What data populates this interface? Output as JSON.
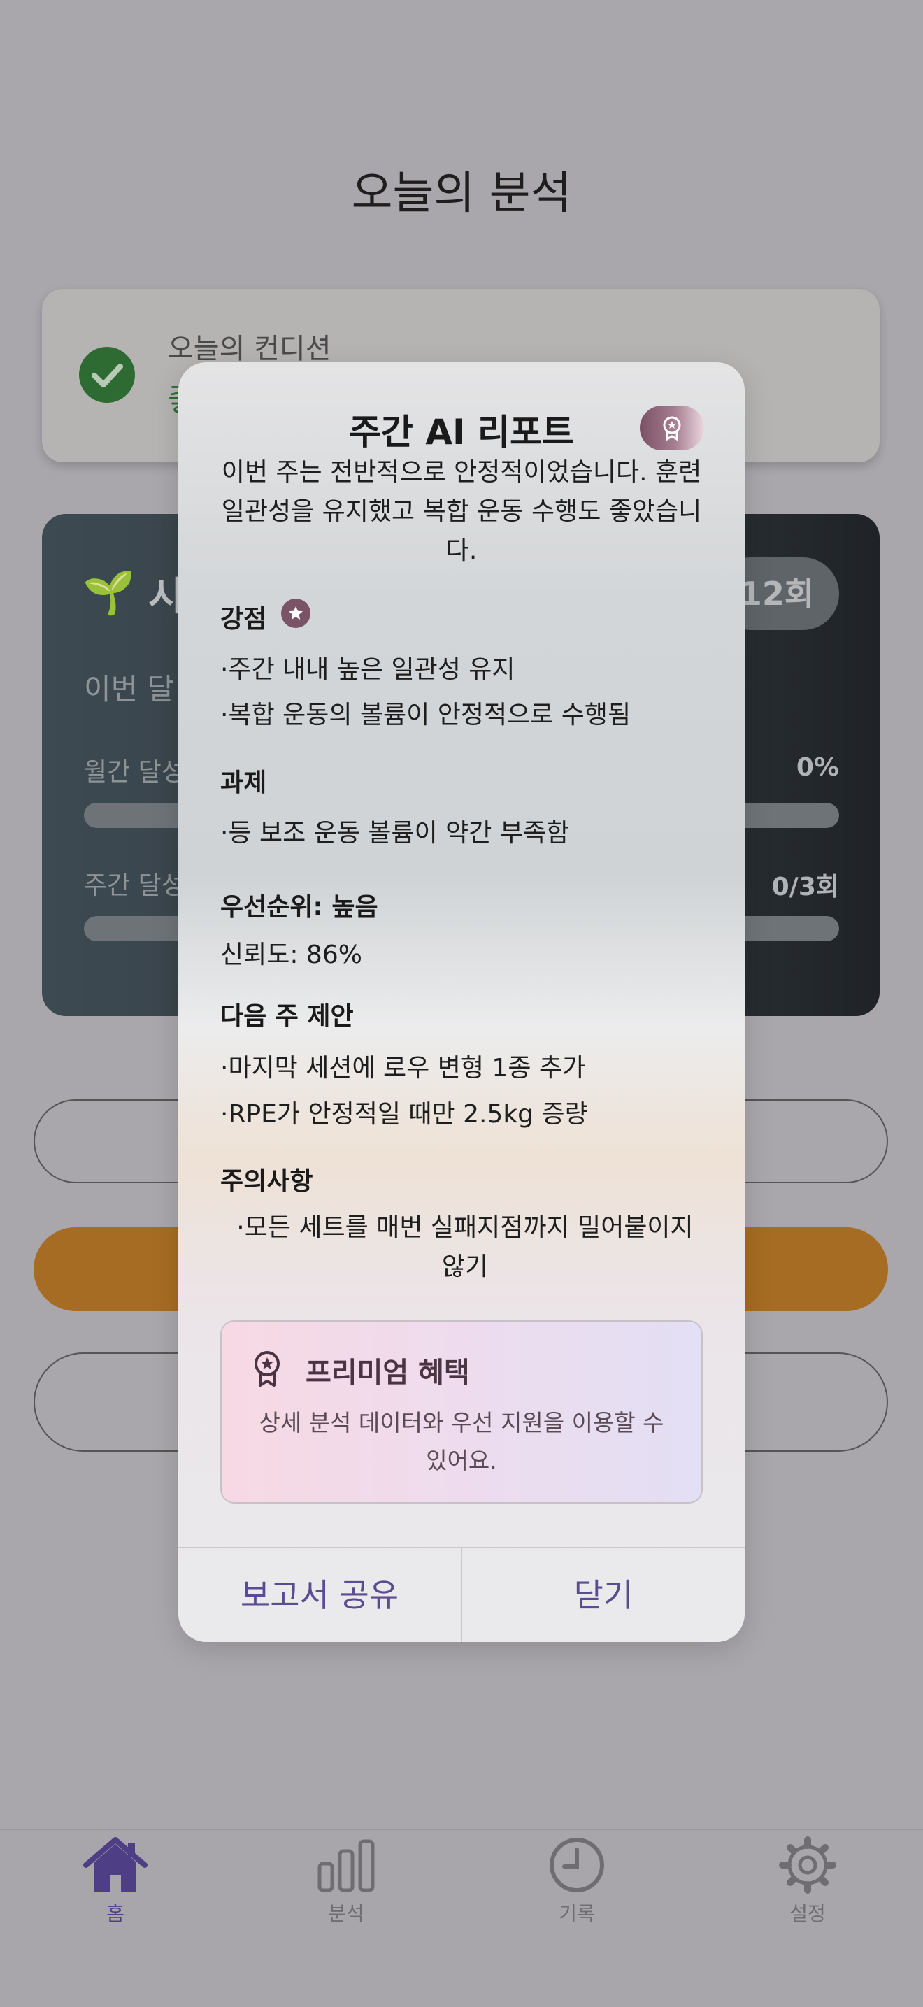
{
  "background": {
    "page_title": "오늘의 분석",
    "condition_card": {
      "label": "오늘의 컨디션",
      "value": "좋음"
    },
    "monthly_card": {
      "title": "시즌",
      "count_badge": "12회",
      "subtitle": "이번 달",
      "monthly_label": "월간 달성",
      "monthly_value": "0%",
      "weekly_label": "주간 달성",
      "weekly_value": "0/3회"
    }
  },
  "modal": {
    "title": "주간 AI 리포트",
    "summary": "이번 주는 전반적으로 안정적이었습니다. 훈련 일관성을 유지했고 복합 운동 수행도 좋았습니다.",
    "strengths": {
      "heading": "강점",
      "items": [
        "·주간 내내 높은 일관성 유지",
        "·복합 운동의 볼륨이 안정적으로 수행됨"
      ]
    },
    "tasks": {
      "heading": "과제",
      "items": [
        "·등 보조 운동 볼륨이 약간 부족함"
      ]
    },
    "priority": "우선순위: 높음",
    "confidence": "신뢰도: 86%",
    "next_week": {
      "heading": "다음 주 제안",
      "items": [
        "·마지막 세션에 로우 변형 1종 추가",
        "·RPE가 안정적일 때만 2.5kg 증량"
      ]
    },
    "caution": {
      "heading": "주의사항",
      "text": "·모든 세트를 매번 실패지점까지 밀어붙이지 않기"
    },
    "premium": {
      "title": "프리미엄 혜택",
      "description": "상세 분석 데이터와 우선 지원을 이용할 수 있어요."
    },
    "share_button": "보고서 공유",
    "close_button": "닫기"
  },
  "tabbar": {
    "items": [
      {
        "label": "홈",
        "icon": "home-icon",
        "active": true
      },
      {
        "label": "분석",
        "icon": "bar-chart-icon",
        "active": false
      },
      {
        "label": "기록",
        "icon": "clock-icon",
        "active": false
      },
      {
        "label": "설정",
        "icon": "gear-icon",
        "active": false
      }
    ],
    "active_color": "#4d3e86",
    "inactive_color": "#6f6d72"
  }
}
